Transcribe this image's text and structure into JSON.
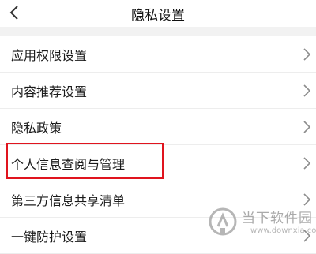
{
  "header": {
    "title": "隐私设置",
    "back_icon": "chevron-left-icon"
  },
  "settings_list": [
    {
      "label": "应用权限设置",
      "icon": "chevron-right-icon"
    },
    {
      "label": "内容推荐设置",
      "icon": "chevron-right-icon"
    },
    {
      "label": "隐私政策",
      "icon": "chevron-right-icon"
    },
    {
      "label": "个人信息查阅与管理",
      "icon": "chevron-right-icon",
      "highlighted": true
    },
    {
      "label": "第三方信息共享清单",
      "icon": "chevron-right-icon"
    },
    {
      "label": "一键防护设置",
      "icon": "chevron-right-icon"
    }
  ],
  "watermark": {
    "name": "当下软件园",
    "url": "www.downxia.com"
  },
  "colors": {
    "highlight_border": "#e0141e",
    "section_gap": "#f2f2f2",
    "chevron": "#8c8c8c"
  }
}
